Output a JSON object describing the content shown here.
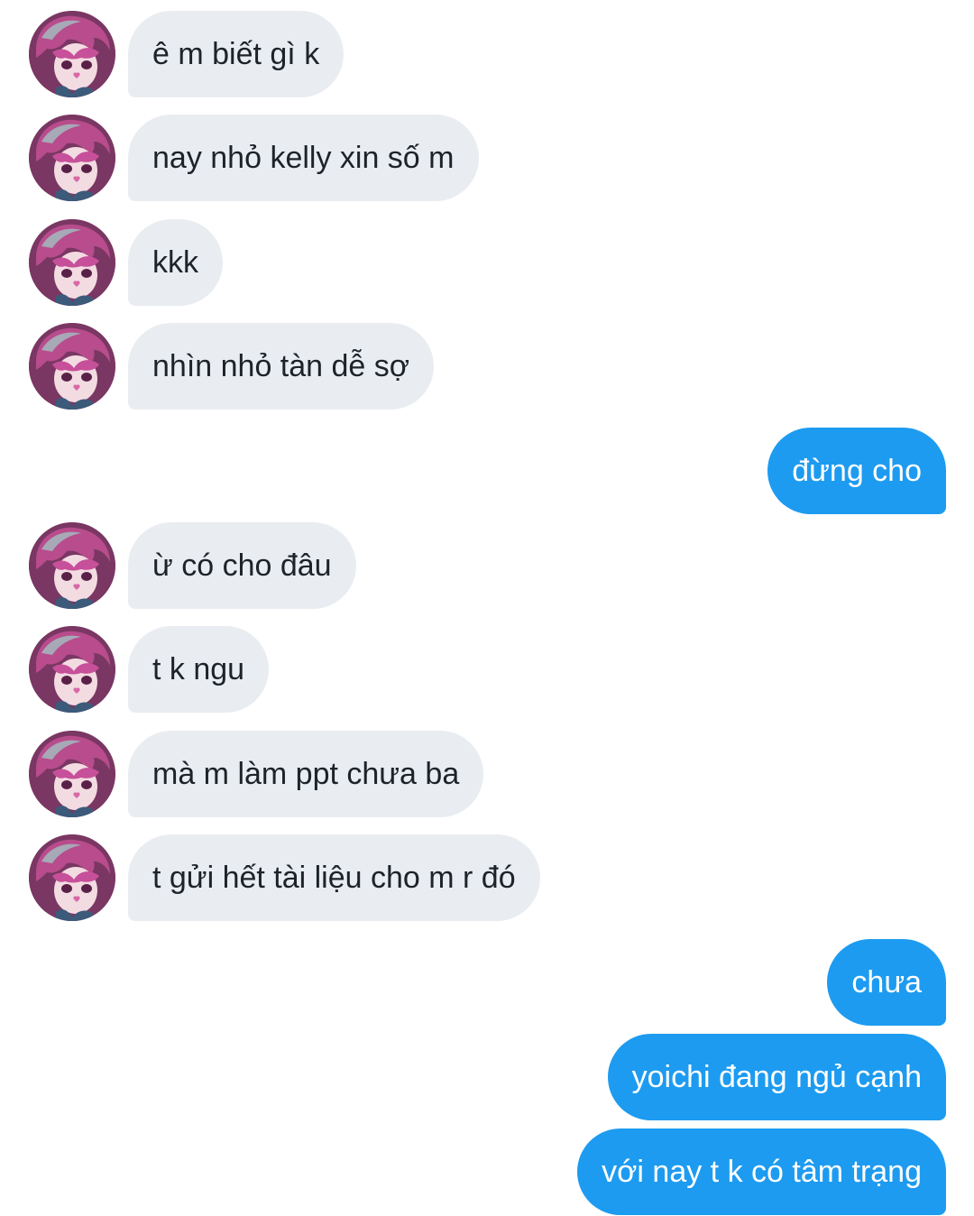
{
  "conversation": {
    "colors": {
      "incoming_bubble": "#e9edf1",
      "incoming_text": "#1d2329",
      "outgoing_bubble": "#1d9bf0",
      "outgoing_text": "#ffffff",
      "background": "#ffffff"
    },
    "avatar_icon": "anime-character-avatar",
    "messages": [
      {
        "direction": "incoming",
        "text": "ê m biết gì k"
      },
      {
        "direction": "incoming",
        "text": "nay nhỏ kelly xin số m"
      },
      {
        "direction": "incoming",
        "text": "kkk"
      },
      {
        "direction": "incoming",
        "text": "nhìn nhỏ tàn dễ sợ"
      },
      {
        "direction": "outgoing",
        "text": "đừng cho"
      },
      {
        "direction": "incoming",
        "text": "ừ có cho đâu"
      },
      {
        "direction": "incoming",
        "text": "t k ngu"
      },
      {
        "direction": "incoming",
        "text": "mà m làm ppt chưa ba"
      },
      {
        "direction": "incoming",
        "text": "t gửi hết tài liệu cho m r đó"
      },
      {
        "direction": "outgoing",
        "text": "chưa"
      },
      {
        "direction": "outgoing",
        "text": "yoichi đang ngủ cạnh"
      },
      {
        "direction": "outgoing",
        "text": "với nay t k có tâm trạng"
      }
    ]
  }
}
